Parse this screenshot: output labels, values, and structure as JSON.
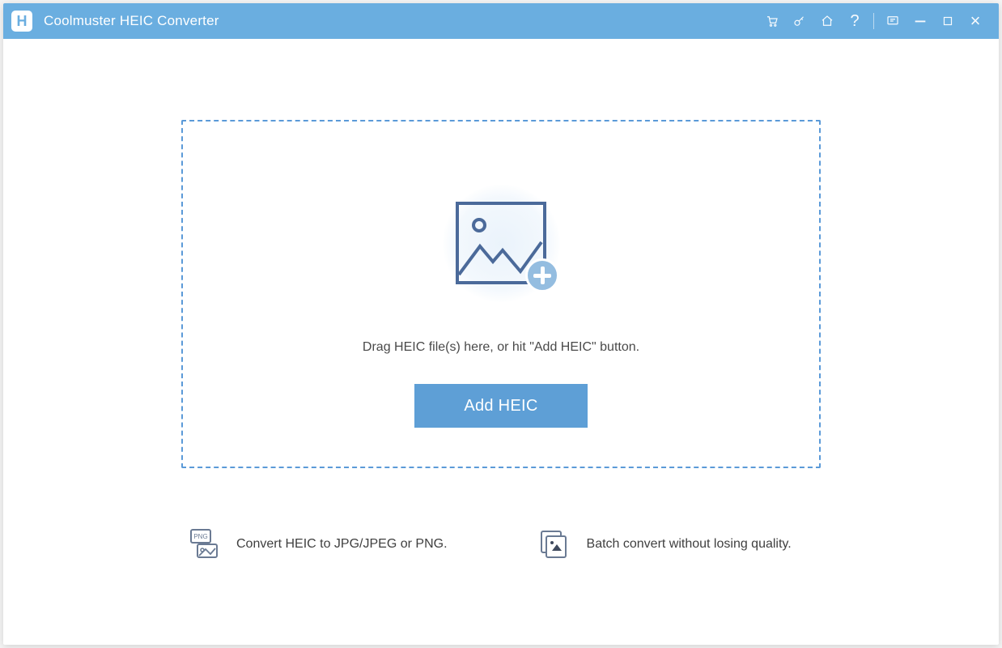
{
  "titlebar": {
    "app_title": "Coolmuster HEIC Converter",
    "icons": {
      "logo": "H",
      "cart": "cart-icon",
      "key": "key-icon",
      "home": "home-icon",
      "help": "?",
      "feedback": "feedback-icon",
      "minimize": "−",
      "maximize": "▢",
      "close": "×"
    }
  },
  "dropzone": {
    "image_add": "image-add-icon",
    "instruction": "Drag HEIC file(s) here, or hit \"Add HEIC\" button.",
    "button_label": "Add HEIC"
  },
  "features": [
    {
      "icon": "png-convert-icon",
      "text": "Convert HEIC to JPG/JPEG or PNG."
    },
    {
      "icon": "batch-icon",
      "text": "Batch convert without losing quality."
    }
  ]
}
